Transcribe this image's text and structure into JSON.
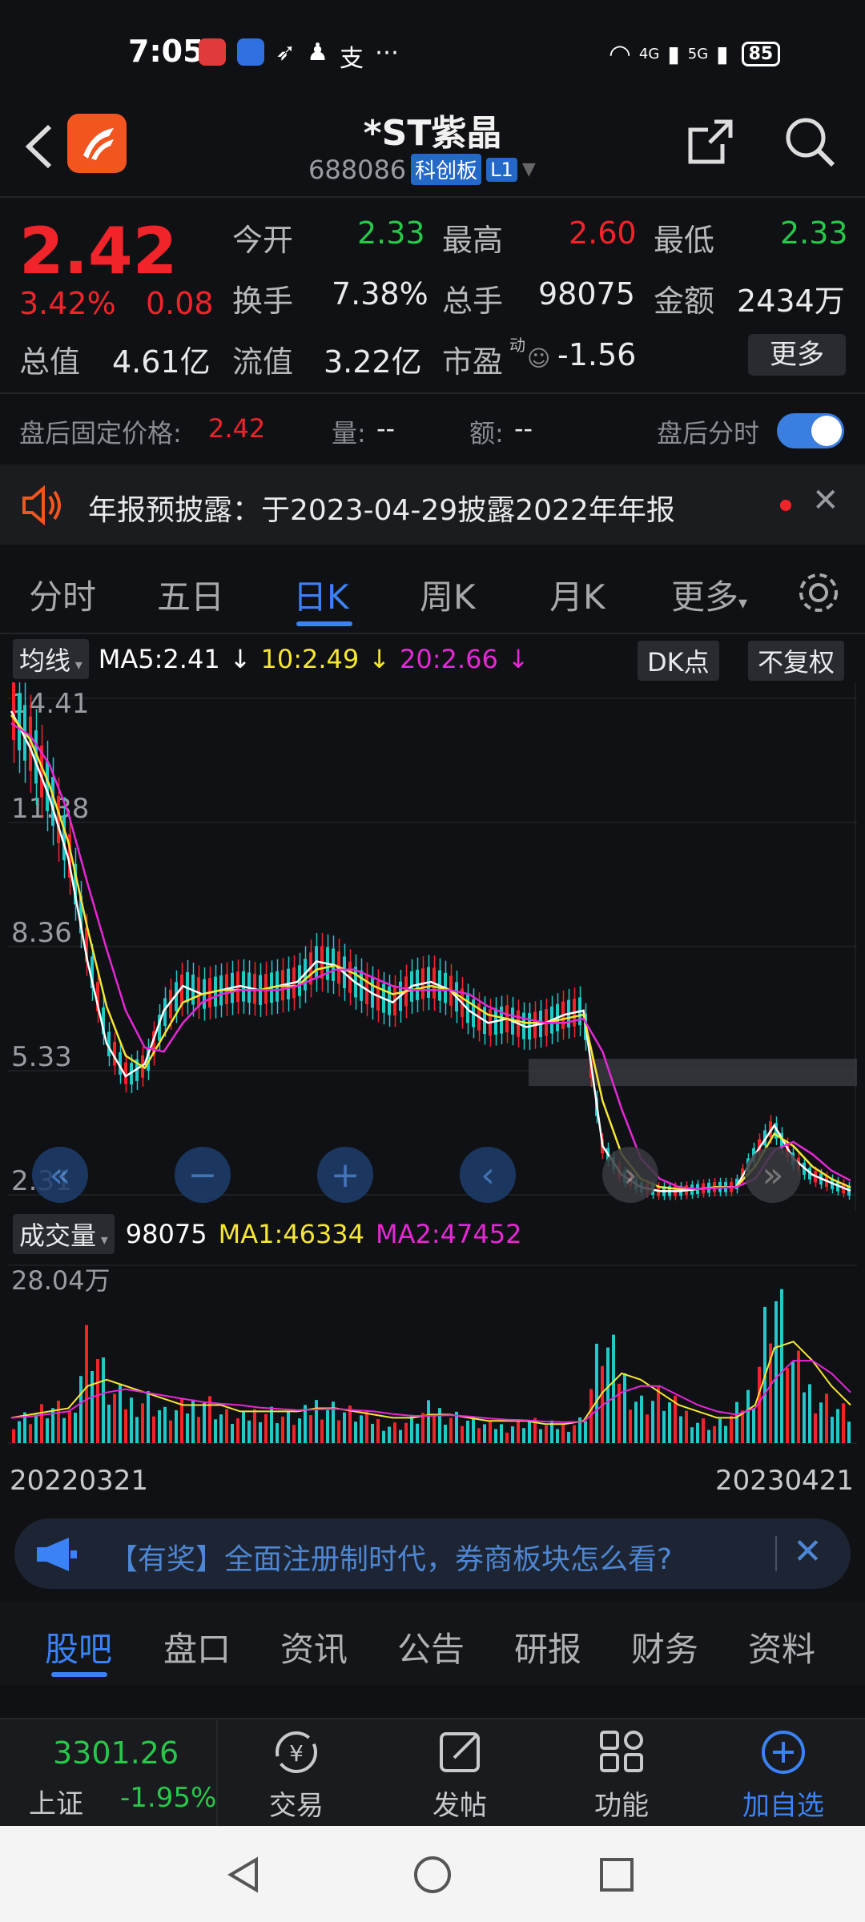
{
  "status_bar": {
    "time": "7:05",
    "battery": "85",
    "net1": "4G",
    "net2": "5G"
  },
  "header": {
    "title": "*ST紫晶",
    "code": "688086",
    "board": "科创板",
    "level": "L1"
  },
  "quote": {
    "price": "2.42",
    "change_pct": "3.42%",
    "change_abs": "0.08",
    "open_label": "今开",
    "open": "2.33",
    "high_label": "最高",
    "high": "2.60",
    "low_label": "最低",
    "low": "2.33",
    "turnover_label": "换手",
    "turnover": "7.38%",
    "volume_label": "总手",
    "volume": "98075",
    "amount_label": "金额",
    "amount": "2434万",
    "mktcap_label": "总值",
    "mktcap": "4.61亿",
    "float_label": "流值",
    "float": "3.22亿",
    "pe_label": "市盈",
    "pe_sup": "动",
    "pe": "-1.56",
    "more_button": "更多"
  },
  "after_hours": {
    "label": "盘后固定价格:",
    "price": "2.42",
    "vol_label": "量:",
    "vol": "--",
    "amt_label": "额:",
    "amt": "--",
    "toggle_label": "盘后分时",
    "toggle_on": true
  },
  "notice": {
    "text": "年报预披露：于2023-04-29披露2022年年报"
  },
  "chart_tabs": [
    "分时",
    "五日",
    "日K",
    "周K",
    "月K",
    "更多"
  ],
  "active_tab": "日K",
  "indicator_bar": {
    "selector": "均线",
    "ma5": "MA5:2.41",
    "ma10": "10:2.49",
    "ma20": "20:2.66",
    "dk": "DK点",
    "adjust": "不复权"
  },
  "volume_bar": {
    "selector": "成交量",
    "vol": "98075",
    "ma1": "MA1:46334",
    "ma2": "MA2:47452"
  },
  "colors": {
    "up": "#f0242a",
    "down": "#27c84a",
    "ma5": "#ffffff",
    "ma10": "#f5e633",
    "ma20": "#e528d6",
    "accent": "#3b82f6",
    "candle_down": "#21c9c9"
  },
  "chart_data": [
    {
      "type": "candlestick",
      "title": "",
      "ylabel": "",
      "yticks": [
        "14.41",
        "11.38",
        "8.36",
        "5.33",
        "2.31"
      ],
      "ylim": [
        2.31,
        14.41
      ],
      "xticks": [
        "20220321",
        "20230421"
      ],
      "series": [
        {
          "name": "MA5",
          "values": [
            14.1,
            13.2,
            12.0,
            10.5,
            8.0,
            6.0,
            5.2,
            5.5,
            6.8,
            7.4,
            7.2,
            7.3,
            7.4,
            7.3,
            7.4,
            7.5,
            8.0,
            7.9,
            7.5,
            7.2,
            7.0,
            7.4,
            7.5,
            7.3,
            6.8,
            6.5,
            6.6,
            6.4,
            6.5,
            6.7,
            6.8,
            3.5,
            2.8,
            2.5,
            2.4,
            2.4,
            2.45,
            2.5,
            2.5,
            3.3,
            4.0,
            3.2,
            2.8,
            2.6,
            2.41
          ]
        },
        {
          "name": "10",
          "values": [
            14.0,
            13.4,
            12.3,
            10.9,
            8.8,
            6.9,
            5.7,
            5.4,
            6.2,
            7.0,
            7.2,
            7.3,
            7.3,
            7.3,
            7.4,
            7.4,
            7.8,
            7.9,
            7.7,
            7.4,
            7.2,
            7.3,
            7.4,
            7.3,
            7.0,
            6.7,
            6.6,
            6.5,
            6.5,
            6.6,
            6.7,
            4.6,
            3.3,
            2.7,
            2.5,
            2.45,
            2.45,
            2.5,
            2.5,
            3.0,
            3.8,
            3.5,
            3.0,
            2.7,
            2.49
          ]
        },
        {
          "name": "20",
          "values": [
            13.8,
            13.5,
            12.8,
            11.6,
            9.9,
            8.3,
            6.8,
            5.9,
            5.8,
            6.5,
            7.0,
            7.2,
            7.3,
            7.3,
            7.3,
            7.4,
            7.6,
            7.8,
            7.8,
            7.6,
            7.4,
            7.3,
            7.3,
            7.3,
            7.2,
            6.9,
            6.7,
            6.6,
            6.5,
            6.5,
            6.6,
            5.8,
            4.4,
            3.2,
            2.7,
            2.5,
            2.45,
            2.48,
            2.5,
            2.7,
            3.4,
            3.6,
            3.3,
            2.9,
            2.66
          ]
        }
      ]
    },
    {
      "type": "bar",
      "title": "",
      "ylabel": "",
      "yticks": [
        "28.04万"
      ],
      "ylim": [
        0,
        28.04
      ],
      "x": [
        "20220321",
        "20230421"
      ],
      "series": [
        {
          "name": "成交量",
          "values": [
            4,
            5,
            6,
            5,
            20,
            9,
            7,
            8,
            5,
            6,
            8,
            5,
            4,
            6,
            5,
            4,
            7,
            6,
            5,
            4,
            3,
            4,
            6,
            5,
            4,
            3,
            3,
            4,
            3,
            3,
            4,
            18,
            12,
            7,
            8,
            6,
            4,
            3,
            5,
            10,
            28.04,
            14,
            9,
            7,
            5
          ]
        },
        {
          "name": "MA1",
          "values": [
            4,
            4.5,
            5,
            5.5,
            9,
            10,
            9,
            8,
            7,
            6,
            6,
            6,
            5,
            5,
            5,
            5,
            5.5,
            5.5,
            5,
            4.5,
            4,
            4,
            4.5,
            4.5,
            4,
            3.5,
            3.5,
            3.5,
            3,
            3,
            3.5,
            8,
            11,
            10,
            8,
            6,
            5,
            4,
            4,
            6,
            15,
            16,
            13,
            9,
            6
          ]
        },
        {
          "name": "MA2",
          "values": [
            4,
            4.2,
            4.6,
            5,
            7,
            8,
            8.5,
            8,
            7.5,
            7,
            6.5,
            6.2,
            6,
            5.6,
            5.4,
            5.2,
            5.3,
            5.4,
            5.2,
            5,
            4.6,
            4.3,
            4.3,
            4.4,
            4.2,
            3.9,
            3.7,
            3.6,
            3.4,
            3.3,
            3.4,
            6,
            8,
            9,
            9,
            7.5,
            6,
            5,
            4.5,
            5.5,
            10,
            13,
            13,
            11,
            8
          ]
        }
      ]
    }
  ],
  "chart_nav": {
    "first": "«",
    "zoom_out": "−",
    "zoom_in": "+",
    "prev": "‹",
    "next": "›",
    "last": "»"
  },
  "promo": {
    "text": "【有奖】全面注册制时代，券商板块怎么看?"
  },
  "bottom_tabs": [
    "股吧",
    "盘口",
    "资讯",
    "公告",
    "研报",
    "财务",
    "资料"
  ],
  "active_bottom_tab": "股吧",
  "index_ticker": {
    "name": "上证",
    "value": "3301.26",
    "change": "-1.95%"
  },
  "toolbar": {
    "trade": "交易",
    "post": "发帖",
    "function": "功能",
    "add": "加自选"
  }
}
